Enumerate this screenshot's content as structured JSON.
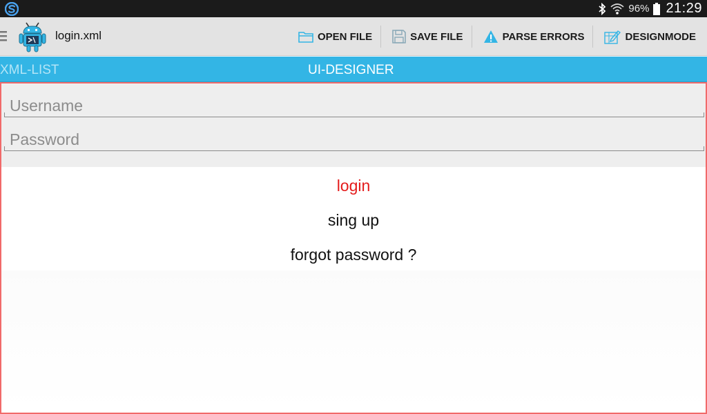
{
  "status_bar": {
    "battery_text": "96%",
    "time": "21:29",
    "icons": [
      "app-s-icon",
      "bluetooth-icon",
      "wifi-icon",
      "battery-icon"
    ]
  },
  "action_bar": {
    "title": "login.xml",
    "actions": [
      {
        "label": "OPEN FILE",
        "icon": "folder-icon"
      },
      {
        "label": "SAVE FILE",
        "icon": "floppy-disk-icon"
      },
      {
        "label": "PARSE ERRORS",
        "icon": "warning-icon"
      },
      {
        "label": "DESIGNMODE",
        "icon": "designmode-icon"
      }
    ]
  },
  "tabs": {
    "xml_list": "XML-LIST",
    "ui_designer": "UI-DESIGNER"
  },
  "designer": {
    "username_placeholder": "Username",
    "password_placeholder": "Password",
    "login_label": "login",
    "signup_label": "sing up",
    "forgot_label": "forgot password ?"
  },
  "colors": {
    "tab_strip": "#33b5e5",
    "action_icon": "#33b5e5",
    "canvas_border": "#f16a6a",
    "login_text": "#e41b1b"
  }
}
